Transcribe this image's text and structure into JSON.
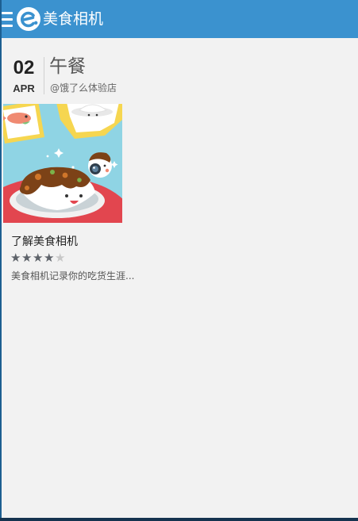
{
  "app": {
    "title": "美食相机",
    "logo_icon": "e-logo-icon",
    "menu_icon": "hamburger-menu-icon",
    "accent_color": "#3b92cf"
  },
  "entry": {
    "day": "02",
    "month": "APR",
    "meal": "午餐",
    "store": "@饿了么体验店"
  },
  "card": {
    "image_icon": "food-illustration",
    "title": "了解美食相机",
    "rating": 4,
    "rating_max": 5,
    "description": "美食相机记录你的吃货生涯..."
  }
}
